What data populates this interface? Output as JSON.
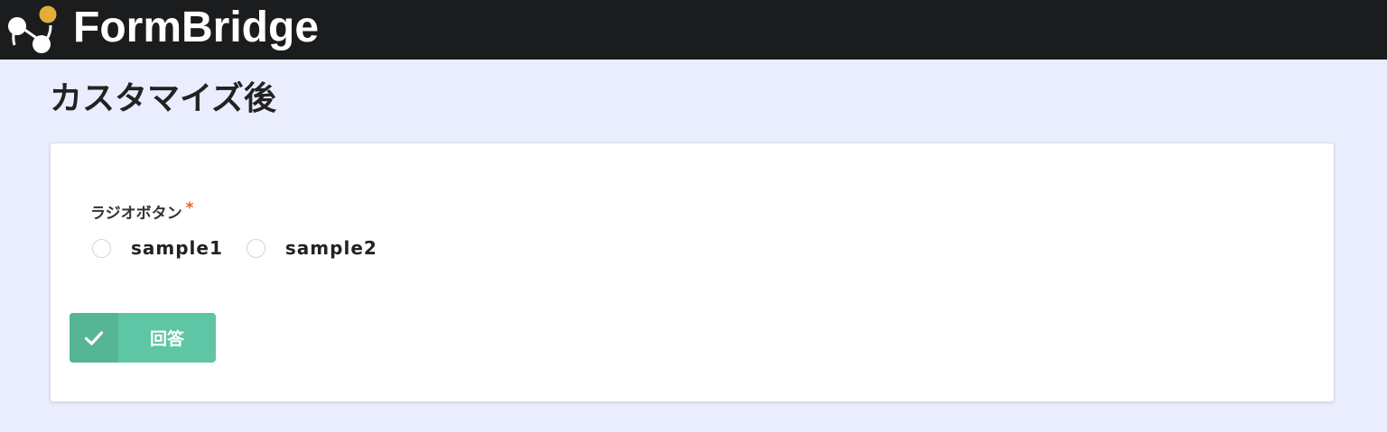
{
  "header": {
    "brand": "FormBridge",
    "logo_icon": "formbridge-logo-icon",
    "background_color": "#1b1c1e",
    "logo_accent_color": "#e2ad3b"
  },
  "page": {
    "title": "カスタマイズ後",
    "background_color": "#e9edfd"
  },
  "form": {
    "field": {
      "label": "ラジオボタン",
      "required_mark": "*",
      "required_color": "#e0662f",
      "options": [
        {
          "label": "sample1",
          "selected": false
        },
        {
          "label": "sample2",
          "selected": false
        }
      ]
    },
    "submit": {
      "label": "回答",
      "icon": "check-icon",
      "color": "#5ec5a5",
      "icon_box_color": "#55b595"
    }
  }
}
